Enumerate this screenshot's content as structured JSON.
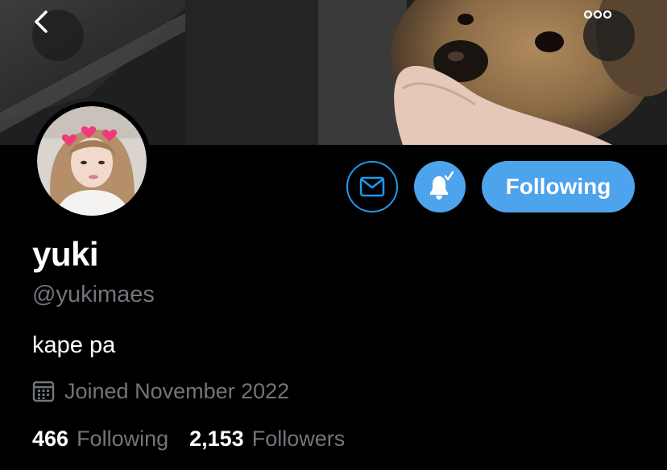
{
  "header": {
    "back_icon": "chevron-left-icon",
    "more_icon": "more-horizontal-icon"
  },
  "actions": {
    "message_icon": "envelope-icon",
    "notify_icon": "bell-check-icon",
    "follow_label": "Following",
    "accent_color": "#4da3ec"
  },
  "profile": {
    "name": "yuki",
    "handle": "@yukimaes",
    "bio": "kape pa",
    "joined": "Joined November 2022",
    "joined_icon": "calendar-icon"
  },
  "stats": {
    "following_count": "466",
    "following_label": "Following",
    "followers_count": "2,153",
    "followers_label": "Followers"
  },
  "colors": {
    "background": "#000000",
    "secondary_text": "#71767b"
  }
}
